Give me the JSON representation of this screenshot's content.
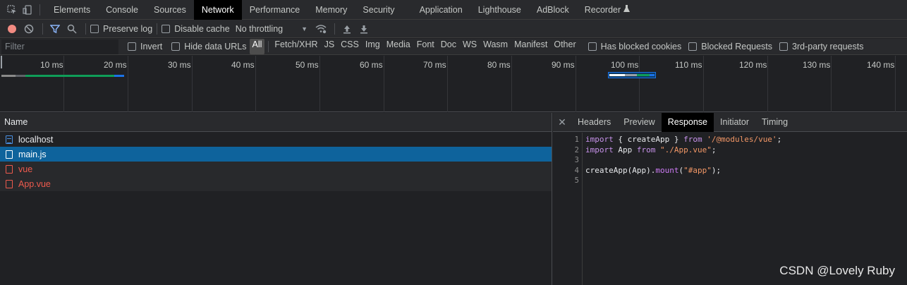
{
  "topbar": {
    "tabs": [
      {
        "label": "Elements"
      },
      {
        "label": "Console"
      },
      {
        "label": "Sources"
      },
      {
        "label": "Network",
        "active": true
      },
      {
        "label": "Performance"
      },
      {
        "label": "Memory"
      },
      {
        "label": "Security"
      },
      {
        "label": "Application"
      },
      {
        "label": "Lighthouse"
      },
      {
        "label": "AdBlock"
      },
      {
        "label": "Recorder"
      }
    ],
    "icons": [
      "inspect-icon",
      "device-toolbar-icon",
      "flask-icon"
    ]
  },
  "toolbar": {
    "preserve_log": "Preserve log",
    "disable_cache": "Disable cache",
    "throttling": "No throttling",
    "icons": [
      "record-icon",
      "clear-icon",
      "filter-icon",
      "search-icon",
      "wifi-settings-icon",
      "upload-icon",
      "download-icon"
    ]
  },
  "filter": {
    "placeholder": "Filter",
    "invert": "Invert",
    "hide_data_urls": "Hide data URLs",
    "types": [
      "All",
      "Fetch/XHR",
      "JS",
      "CSS",
      "Img",
      "Media",
      "Font",
      "Doc",
      "WS",
      "Wasm",
      "Manifest",
      "Other"
    ],
    "active_type": "All",
    "has_blocked_cookies": "Has blocked cookies",
    "blocked_requests": "Blocked Requests",
    "third_party": "3rd-party requests"
  },
  "overview": {
    "ticks": [
      "10 ms",
      "20 ms",
      "30 ms",
      "40 ms",
      "50 ms",
      "60 ms",
      "70 ms",
      "80 ms",
      "90 ms",
      "100 ms",
      "110 ms",
      "120 ms",
      "130 ms",
      "140 ms"
    ]
  },
  "requests": {
    "header": "Name",
    "rows": [
      {
        "name": "localhost",
        "type": "doc",
        "state": "normal"
      },
      {
        "name": "main.js",
        "type": "script",
        "state": "selected"
      },
      {
        "name": "vue",
        "type": "error",
        "state": "error"
      },
      {
        "name": "App.vue",
        "type": "error",
        "state": "error"
      }
    ]
  },
  "detail": {
    "tabs": [
      "Headers",
      "Preview",
      "Response",
      "Initiator",
      "Timing"
    ],
    "active_tab": "Response",
    "line_numbers": [
      "1",
      "2",
      "3",
      "4",
      "5"
    ],
    "code": {
      "l1": {
        "kw1": "import",
        "mid": " { createApp } ",
        "kw2": "from",
        "sp": " ",
        "str": "'/@modules/vue'",
        "end": ";"
      },
      "l2": {
        "kw1": "import",
        "mid": " App ",
        "kw2": "from",
        "sp": " ",
        "str": "\"./App.vue\"",
        "end": ";"
      },
      "l4": {
        "a": "createApp(App).",
        "kw": "mount",
        "b": "(",
        "str": "\"#app\"",
        "end": ");"
      }
    }
  },
  "watermark": "CSDN @Lovely Ruby",
  "colors": {
    "selected_row": "#0e639c",
    "error_text": "#ee5a4d",
    "record": "#f28b82"
  }
}
